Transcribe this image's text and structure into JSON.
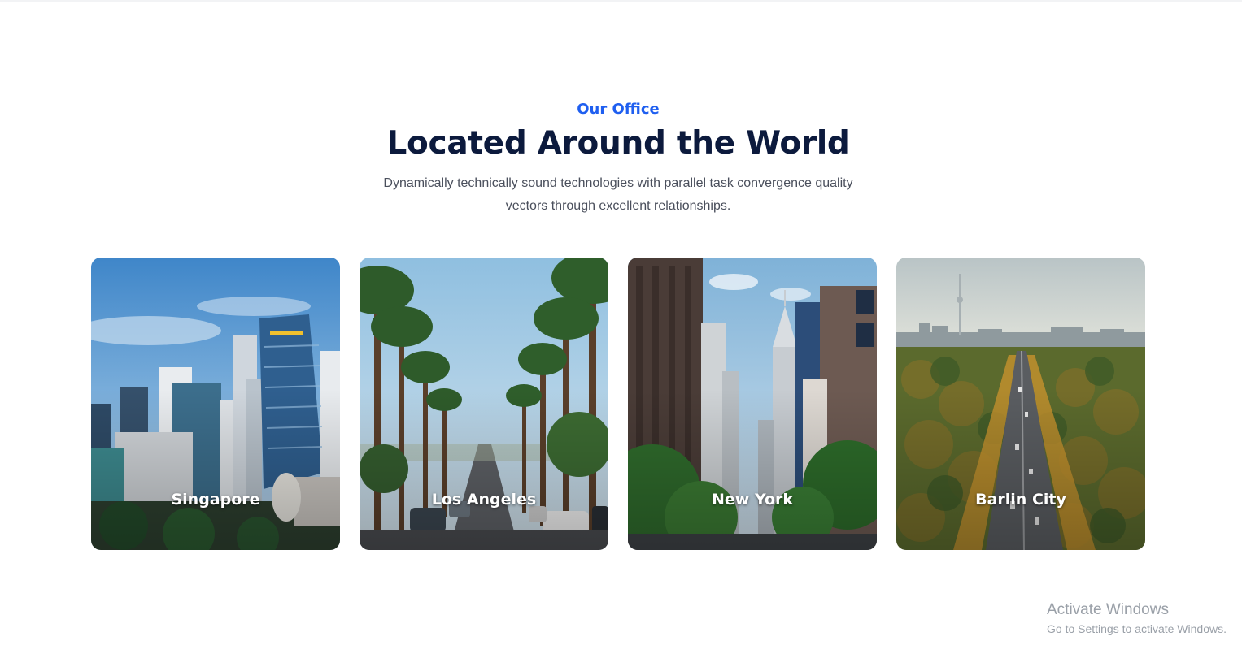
{
  "section": {
    "eyebrow": "Our Office",
    "title": "Located Around the World",
    "description": "Dynamically technically sound technologies with parallel task convergence quality vectors through excellent relationships."
  },
  "offices": [
    {
      "city": "Singapore",
      "image": "singapore-skyline-image"
    },
    {
      "city": "Los Angeles",
      "image": "los-angeles-palm-street-image"
    },
    {
      "city": "New York",
      "image": "new-york-street-image"
    },
    {
      "city": "Barlin City",
      "image": "berlin-aerial-boulevard-image"
    }
  ],
  "watermark": {
    "title": "Activate Windows",
    "subtitle": "Go to Settings to activate Windows."
  },
  "colors": {
    "accent": "#1f5ff0",
    "heading": "#0c1a3d",
    "body_text": "#4a4f5c"
  }
}
